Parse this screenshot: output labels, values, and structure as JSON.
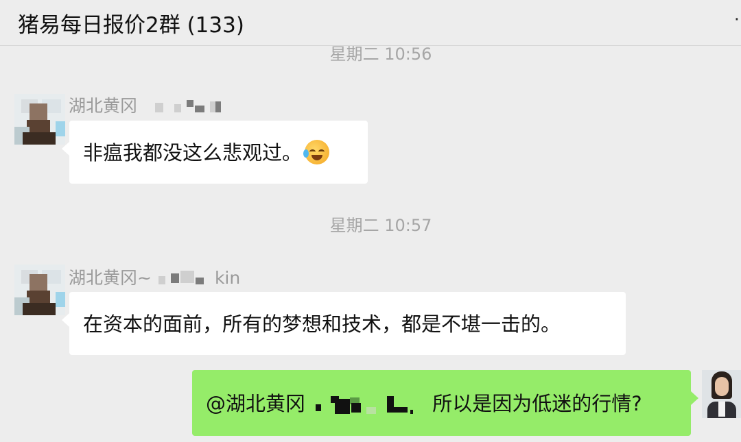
{
  "header": {
    "title": "猪易每日报价2群 (133)",
    "more_icon": "more-dots-icon"
  },
  "messages": [
    {
      "time": "星期二 10:56",
      "sender": "湖北黄冈",
      "sender_tail": "",
      "text": "非瘟我都没这么悲观过。",
      "emoji": "face-with-tears-of-joy-emoji"
    },
    {
      "time": "星期二 10:57",
      "sender": "湖北黄冈~",
      "sender_tail": "kin",
      "text": "在资本的面前，所有的梦想和技术，都是不堪一击的。"
    },
    {
      "mention": "@湖北黄冈",
      "text": "所以是因为低迷的行情?",
      "own": true
    }
  ],
  "colors": {
    "background": "#ededed",
    "incoming_bubble": "#ffffff",
    "outgoing_bubble": "#95ec69",
    "time_text": "#a6a6a6",
    "sender_text": "#9a9a9a"
  }
}
